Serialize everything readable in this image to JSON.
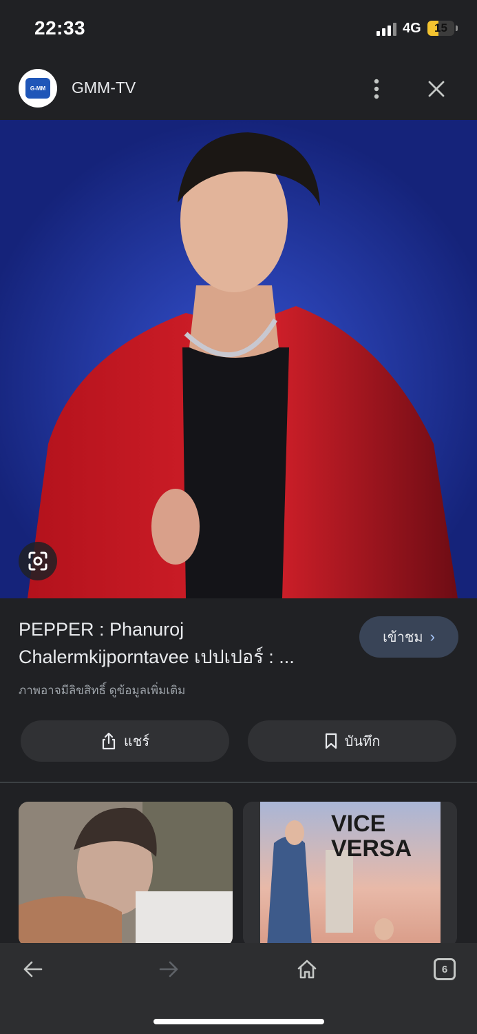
{
  "status_bar": {
    "time": "22:33",
    "network": "4G",
    "battery_level": "15",
    "battery_fraction": 0.4,
    "battery_color": "#f4c430"
  },
  "header": {
    "logo_text": "G-MM",
    "site_name": "GMM-TV",
    "more_icon": "more-vert-icon",
    "close_icon": "close-icon"
  },
  "image": {
    "background_color": "#1c2f9a",
    "lens_icon": "google-lens-icon"
  },
  "result": {
    "title": "PEPPER : Phanuroj Chalermkijporntavee เปปเปอร์ : ...",
    "visit_label": "เข้าชม",
    "copyright_note": "ภาพอาจมีลิขสิทธิ์ ดูข้อมูลเพิ่มเติม",
    "share_label": "แชร์",
    "save_label": "บันทึก"
  },
  "related": {
    "item2_title": "VICE VERSA"
  },
  "bottom_bar": {
    "tab_count": "6"
  }
}
